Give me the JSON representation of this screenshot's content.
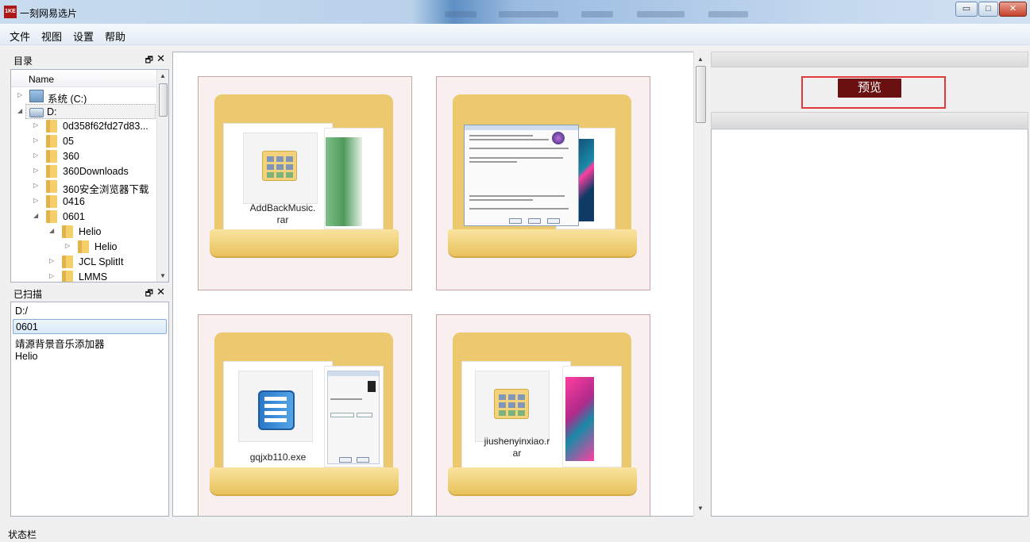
{
  "window": {
    "app_icon_text": "1KE",
    "title": "一刻网易选片",
    "controls": {
      "minimize": "▭",
      "maximize": "□",
      "close": "✕"
    }
  },
  "menu": [
    {
      "label": "文件"
    },
    {
      "label": "视图"
    },
    {
      "label": "设置"
    },
    {
      "label": "帮助"
    }
  ],
  "directory_panel": {
    "title": "目录",
    "float_icon": "🗗",
    "close_icon": "✕",
    "column_header": "Name",
    "items": [
      {
        "label": "系统 (C:)",
        "icon": "system-drive-icon",
        "expanded": false,
        "level": 0
      },
      {
        "label": "D:",
        "icon": "drive-icon",
        "expanded": true,
        "level": 0,
        "selected": true
      },
      {
        "label": "0d358f62fd27d83...",
        "icon": "folder-icon",
        "expanded": false,
        "level": 1
      },
      {
        "label": "05",
        "icon": "folder-icon",
        "expanded": false,
        "level": 1
      },
      {
        "label": "360",
        "icon": "folder-icon",
        "expanded": false,
        "level": 1
      },
      {
        "label": "360Downloads",
        "icon": "folder-icon",
        "expanded": false,
        "level": 1
      },
      {
        "label": "360安全浏览器下载",
        "icon": "folder-icon",
        "expanded": false,
        "level": 1
      },
      {
        "label": "0416",
        "icon": "folder-icon",
        "expanded": false,
        "level": 1
      },
      {
        "label": "0601",
        "icon": "folder-icon",
        "expanded": true,
        "level": 1
      },
      {
        "label": "Helio",
        "icon": "folder-icon",
        "expanded": true,
        "level": 2
      },
      {
        "label": "Helio",
        "icon": "folder-icon",
        "expanded": false,
        "level": 3
      },
      {
        "label": "JCL SplitIt",
        "icon": "folder-icon",
        "expanded": false,
        "level": 2
      },
      {
        "label": "LMMS",
        "icon": "folder-icon",
        "expanded": false,
        "level": 2
      }
    ]
  },
  "scanned_panel": {
    "title": "已扫描",
    "float_icon": "🗗",
    "close_icon": "✕",
    "items": [
      {
        "label": "D:/",
        "selected": false
      },
      {
        "label": "0601",
        "selected": true
      },
      {
        "label": "靖源背景音乐添加器",
        "selected": false
      },
      {
        "label": "Helio",
        "selected": false
      }
    ]
  },
  "grid": {
    "folders": [
      {
        "file_label": "AddBackMusic.\nrar",
        "preview": "music-disc"
      },
      {
        "file_label": "",
        "preview": "installer-dialog"
      },
      {
        "file_label": "gqjxb110.exe",
        "preview": "piano-app"
      },
      {
        "file_label": "jiushenyinxiao.r\nar",
        "preview": "archive"
      }
    ]
  },
  "right_panel": {
    "preview_button": "预览"
  },
  "status_bar": {
    "text": "状态栏"
  },
  "colors": {
    "preview_button_bg": "#6b1010",
    "highlight_border": "#e23a3a",
    "folder": "#ecc96f"
  }
}
